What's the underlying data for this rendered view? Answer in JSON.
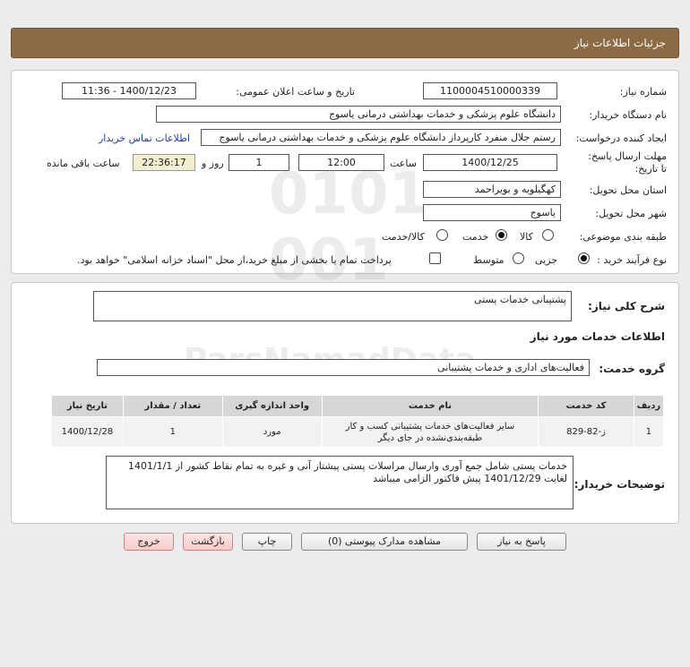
{
  "header": {
    "title": "جزئیات اطلاعات نیاز"
  },
  "form": {
    "need_number_label": "شماره نیاز:",
    "need_number": "1100004510000339",
    "announce_label": "تاریخ و ساعت اعلان عمومی:",
    "announce_value": "1400/12/23 - 11:36",
    "buyer_org_label": "نام دستگاه خریدار:",
    "buyer_org": "دانشگاه علوم پزشکی و خدمات بهداشتی  درمانی یاسوج",
    "creator_label": "ایجاد کننده درخواست:",
    "creator": "رستم جلال منفرد کارپرداز دانشگاه علوم پزشکی و خدمات بهداشتی  درمانی یاسوج",
    "contact_link": "اطلاعات تماس خریدار",
    "deadline_label": "مهلت ارسال پاسخ: تا تاریخ:",
    "deadline_date": "1400/12/25",
    "time_label": "ساعت",
    "deadline_time": "12:00",
    "days_value": "1",
    "days_label": "روز و",
    "remaining_time": "22:36:17",
    "remaining_label": "ساعت باقی مانده",
    "province_label": "استان محل تحویل:",
    "province": "کهگیلویه و بویراحمد",
    "city_label": "شهر محل تحویل:",
    "city": "یاسوج",
    "category_label": "طبقه بندی موضوعی:",
    "category_options": [
      "کالا",
      "خدمت",
      "کالا/خدمت"
    ],
    "process_label": "نوع فرآیند خرید :",
    "process_options": [
      "جزیی",
      "متوسط"
    ],
    "treasury_note": "پرداخت تمام یا بخشی از مبلغ خرید،از محل \"اسناد خزانه اسلامی\" خواهد بود."
  },
  "summary": {
    "label": "شرح کلی نیاز:",
    "value": "پشتیبانی خدمات پستی",
    "services_title": "اطلاعات خدمات مورد نیاز",
    "group_label": "گروه خدمت:",
    "group_value": "فعالیت‌های اداری و خدمات پشتیبانی"
  },
  "table": {
    "headers": [
      "ردیف",
      "کد خدمت",
      "نام خدمت",
      "واحد اندازه گیری",
      "تعداد / مقدار",
      "تاریخ نیاز"
    ],
    "rows": [
      [
        "1",
        "ز-82-829",
        "سایر فعالیت‌های خدمات پشتیبانی کسب و کار طبقه‌بندی‌نشده در جای دیگر",
        "مورد",
        "1",
        "1400/12/28"
      ]
    ]
  },
  "description": {
    "label": "توضیحات خریدار:",
    "value": "خدمات پستی شامل جمع آوری وارسال مراسلات پستی پیشتاز آنی و غیره به تمام نقاط کشور از 1401/1/1 لغایت 1401/12/29  پیش فاکتور الزامی میباشد"
  },
  "buttons": {
    "reply": "پاسخ به نیاز",
    "attachments": "مشاهده مدارک پیوستی (0)",
    "print": "چاپ",
    "back": "بازگشت",
    "exit": "خروج"
  }
}
